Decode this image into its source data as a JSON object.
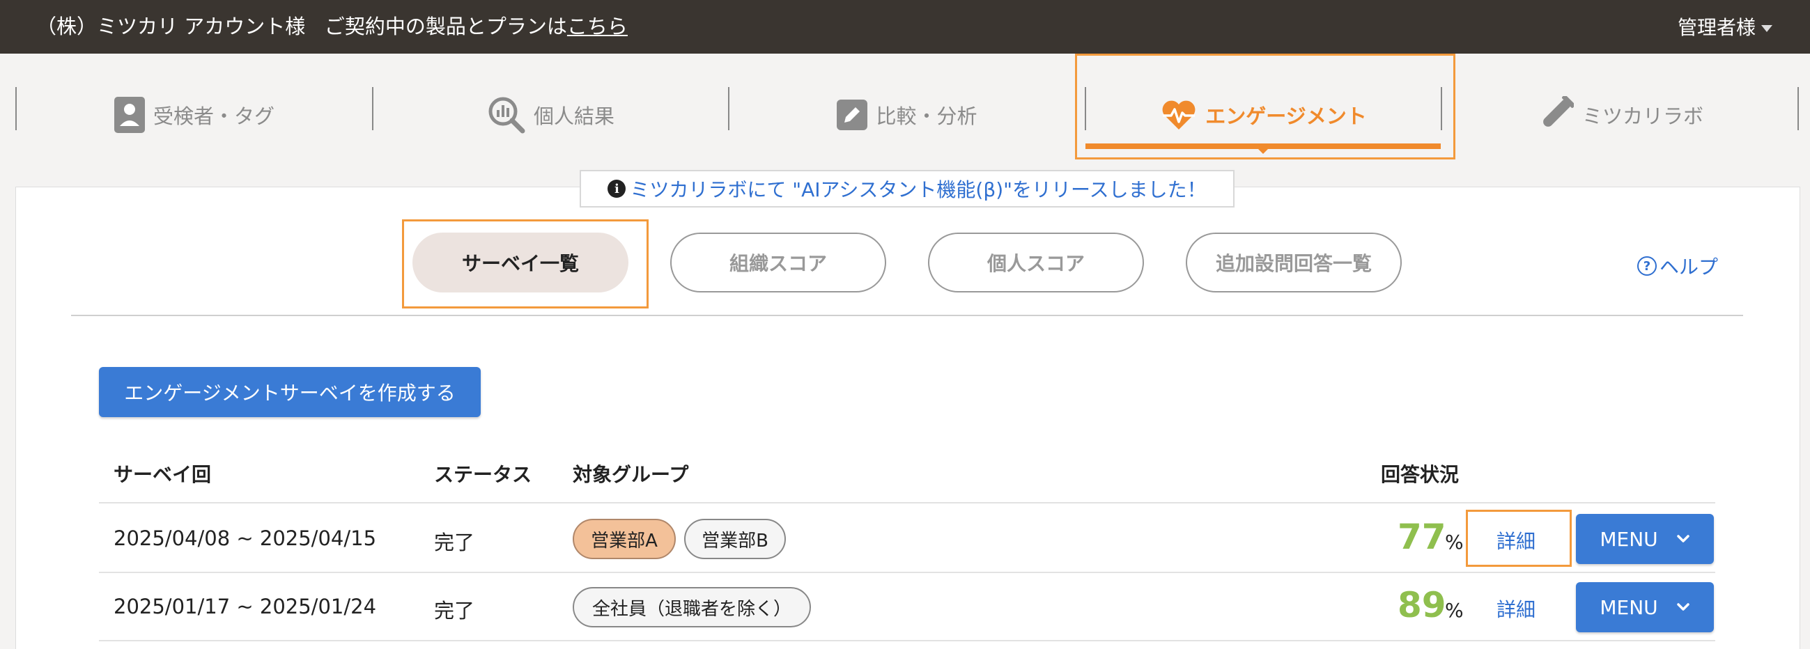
{
  "topbar": {
    "company": "（株）ミツカリ アカウント様",
    "plan_text": "ご契約中の製品とプランは",
    "plan_link": "こちら",
    "admin": "管理者様"
  },
  "nav": {
    "items": [
      {
        "label": "受検者・タグ",
        "icon": "user-card-icon"
      },
      {
        "label": "個人結果",
        "icon": "chart-search-icon"
      },
      {
        "label": "比較・分析",
        "icon": "edit-icon"
      },
      {
        "label": "エンゲージメント",
        "icon": "heartbeat-icon"
      },
      {
        "label": "ミツカリラボ",
        "icon": "test-tube-icon"
      }
    ],
    "active_index": 3
  },
  "notice": {
    "text": "ミツカリラボにて \"AIアシスタント機能(β)\"をリリースしました！"
  },
  "subtabs": [
    "サーベイ一覧",
    "組織スコア",
    "個人スコア",
    "追加設問回答一覧"
  ],
  "help_label": "ヘルプ",
  "create_button": "エンゲージメントサーベイを作成する",
  "table": {
    "headers": [
      "サーベイ回",
      "ステータス",
      "対象グループ",
      "回答状況"
    ],
    "rows": [
      {
        "period": "2025/04/08 ~ 2025/04/15",
        "status": "完了",
        "groups": [
          "営業部A",
          "営業部B"
        ],
        "rate": "77",
        "unit": "%",
        "detail": "詳細",
        "menu": "MENU"
      },
      {
        "period": "2025/01/17 ~ 2025/01/24",
        "status": "完了",
        "groups": [
          "全社員（退職者を除く）"
        ],
        "rate": "89",
        "unit": "%",
        "detail": "詳細",
        "menu": "MENU"
      }
    ]
  },
  "colors": {
    "accent": "#f08a2c",
    "primary": "#3a7bd5",
    "topbar": "#3a3530",
    "rate": "#8fbf4e",
    "highlight": "#f39a3c"
  }
}
